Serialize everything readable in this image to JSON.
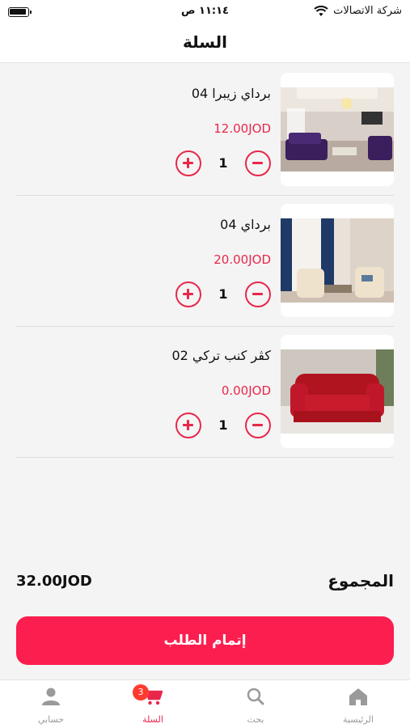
{
  "status_bar": {
    "carrier": "شركة الاتصالات",
    "time": "١١:١٤ ص"
  },
  "header": {
    "title": "السلة"
  },
  "cart": {
    "items": [
      {
        "name": "برداي زيبرا 04",
        "price": "12.00JOD",
        "quantity": "1",
        "image": "living-room-purple-sofas"
      },
      {
        "name": "برداي 04",
        "price": "20.00JOD",
        "quantity": "1",
        "image": "curtains-armchairs"
      },
      {
        "name": "كڤر كنب تركي 02",
        "price": "0.00JOD",
        "quantity": "1",
        "image": "red-sofa-cover"
      }
    ]
  },
  "summary": {
    "total_label": "المجموع",
    "total_value": "32.00JOD"
  },
  "checkout": {
    "label": "إتمام الطلب"
  },
  "tabs": [
    {
      "label": "الرئيسية",
      "icon": "home-icon"
    },
    {
      "label": "بحث",
      "icon": "search-icon"
    },
    {
      "label": "السلة",
      "icon": "cart-icon",
      "badge": "3",
      "active": true
    },
    {
      "label": "حسابي",
      "icon": "user-icon"
    }
  ],
  "colors": {
    "accent": "#e8274b",
    "button": "#fc1e4e",
    "badge": "#ff3b30"
  }
}
